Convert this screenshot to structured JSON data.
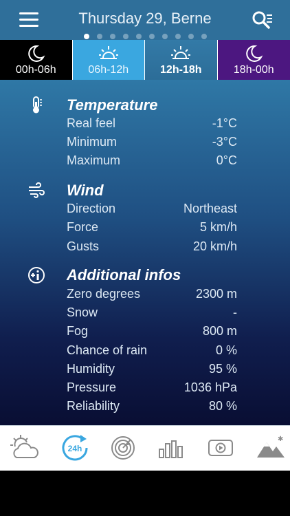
{
  "header": {
    "title": "Thursday 29, Berne",
    "page_dots": {
      "count": 10,
      "active_index": 0
    }
  },
  "tabs": [
    {
      "label": "00h-06h",
      "icon": "moon-icon",
      "selected": false
    },
    {
      "label": "06h-12h",
      "icon": "sun-icon",
      "selected": false
    },
    {
      "label": "12h-18h",
      "icon": "sun-icon",
      "selected": true
    },
    {
      "label": "18h-00h",
      "icon": "moon-icon",
      "selected": false
    }
  ],
  "sections": {
    "temperature": {
      "title": "Temperature",
      "icon": "thermometer-icon",
      "rows": [
        {
          "label": "Real feel",
          "value": "-1°C"
        },
        {
          "label": "Minimum",
          "value": "-3°C"
        },
        {
          "label": "Maximum",
          "value": "0°C"
        }
      ]
    },
    "wind": {
      "title": "Wind",
      "icon": "wind-icon",
      "rows": [
        {
          "label": "Direction",
          "value": "Northeast"
        },
        {
          "label": "Force",
          "value": "5 km/h"
        },
        {
          "label": "Gusts",
          "value": "20 km/h"
        }
      ]
    },
    "additional": {
      "title": "Additional infos",
      "icon": "info-plus-icon",
      "rows": [
        {
          "label": "Zero degrees",
          "value": "2300 m"
        },
        {
          "label": "Snow",
          "value": "-"
        },
        {
          "label": "Fog",
          "value": "800 m"
        },
        {
          "label": "Chance of rain",
          "value": "0 %"
        },
        {
          "label": "Humidity",
          "value": "95 %"
        },
        {
          "label": "Pressure",
          "value": "1036 hPa"
        },
        {
          "label": "Reliability",
          "value": "80 %"
        }
      ]
    }
  },
  "bottom_nav": [
    {
      "icon": "weather-sun-cloud-icon",
      "active": false
    },
    {
      "icon": "24h-forecast-icon",
      "label": "24h",
      "active": true
    },
    {
      "icon": "radar-icon",
      "active": false
    },
    {
      "icon": "bar-chart-icon",
      "active": false
    },
    {
      "icon": "video-play-icon",
      "active": false
    },
    {
      "icon": "mountain-snow-icon",
      "active": false
    }
  ],
  "colors": {
    "header_bg": "#2f6f9a",
    "tab_night": "#000000",
    "tab_morning": "#3aa7e0",
    "tab_afternoon": "#2f75a2",
    "tab_evening": "#4c1780",
    "accent_icon": "#3aa7e0",
    "icon_gray": "#8a8a8a"
  }
}
